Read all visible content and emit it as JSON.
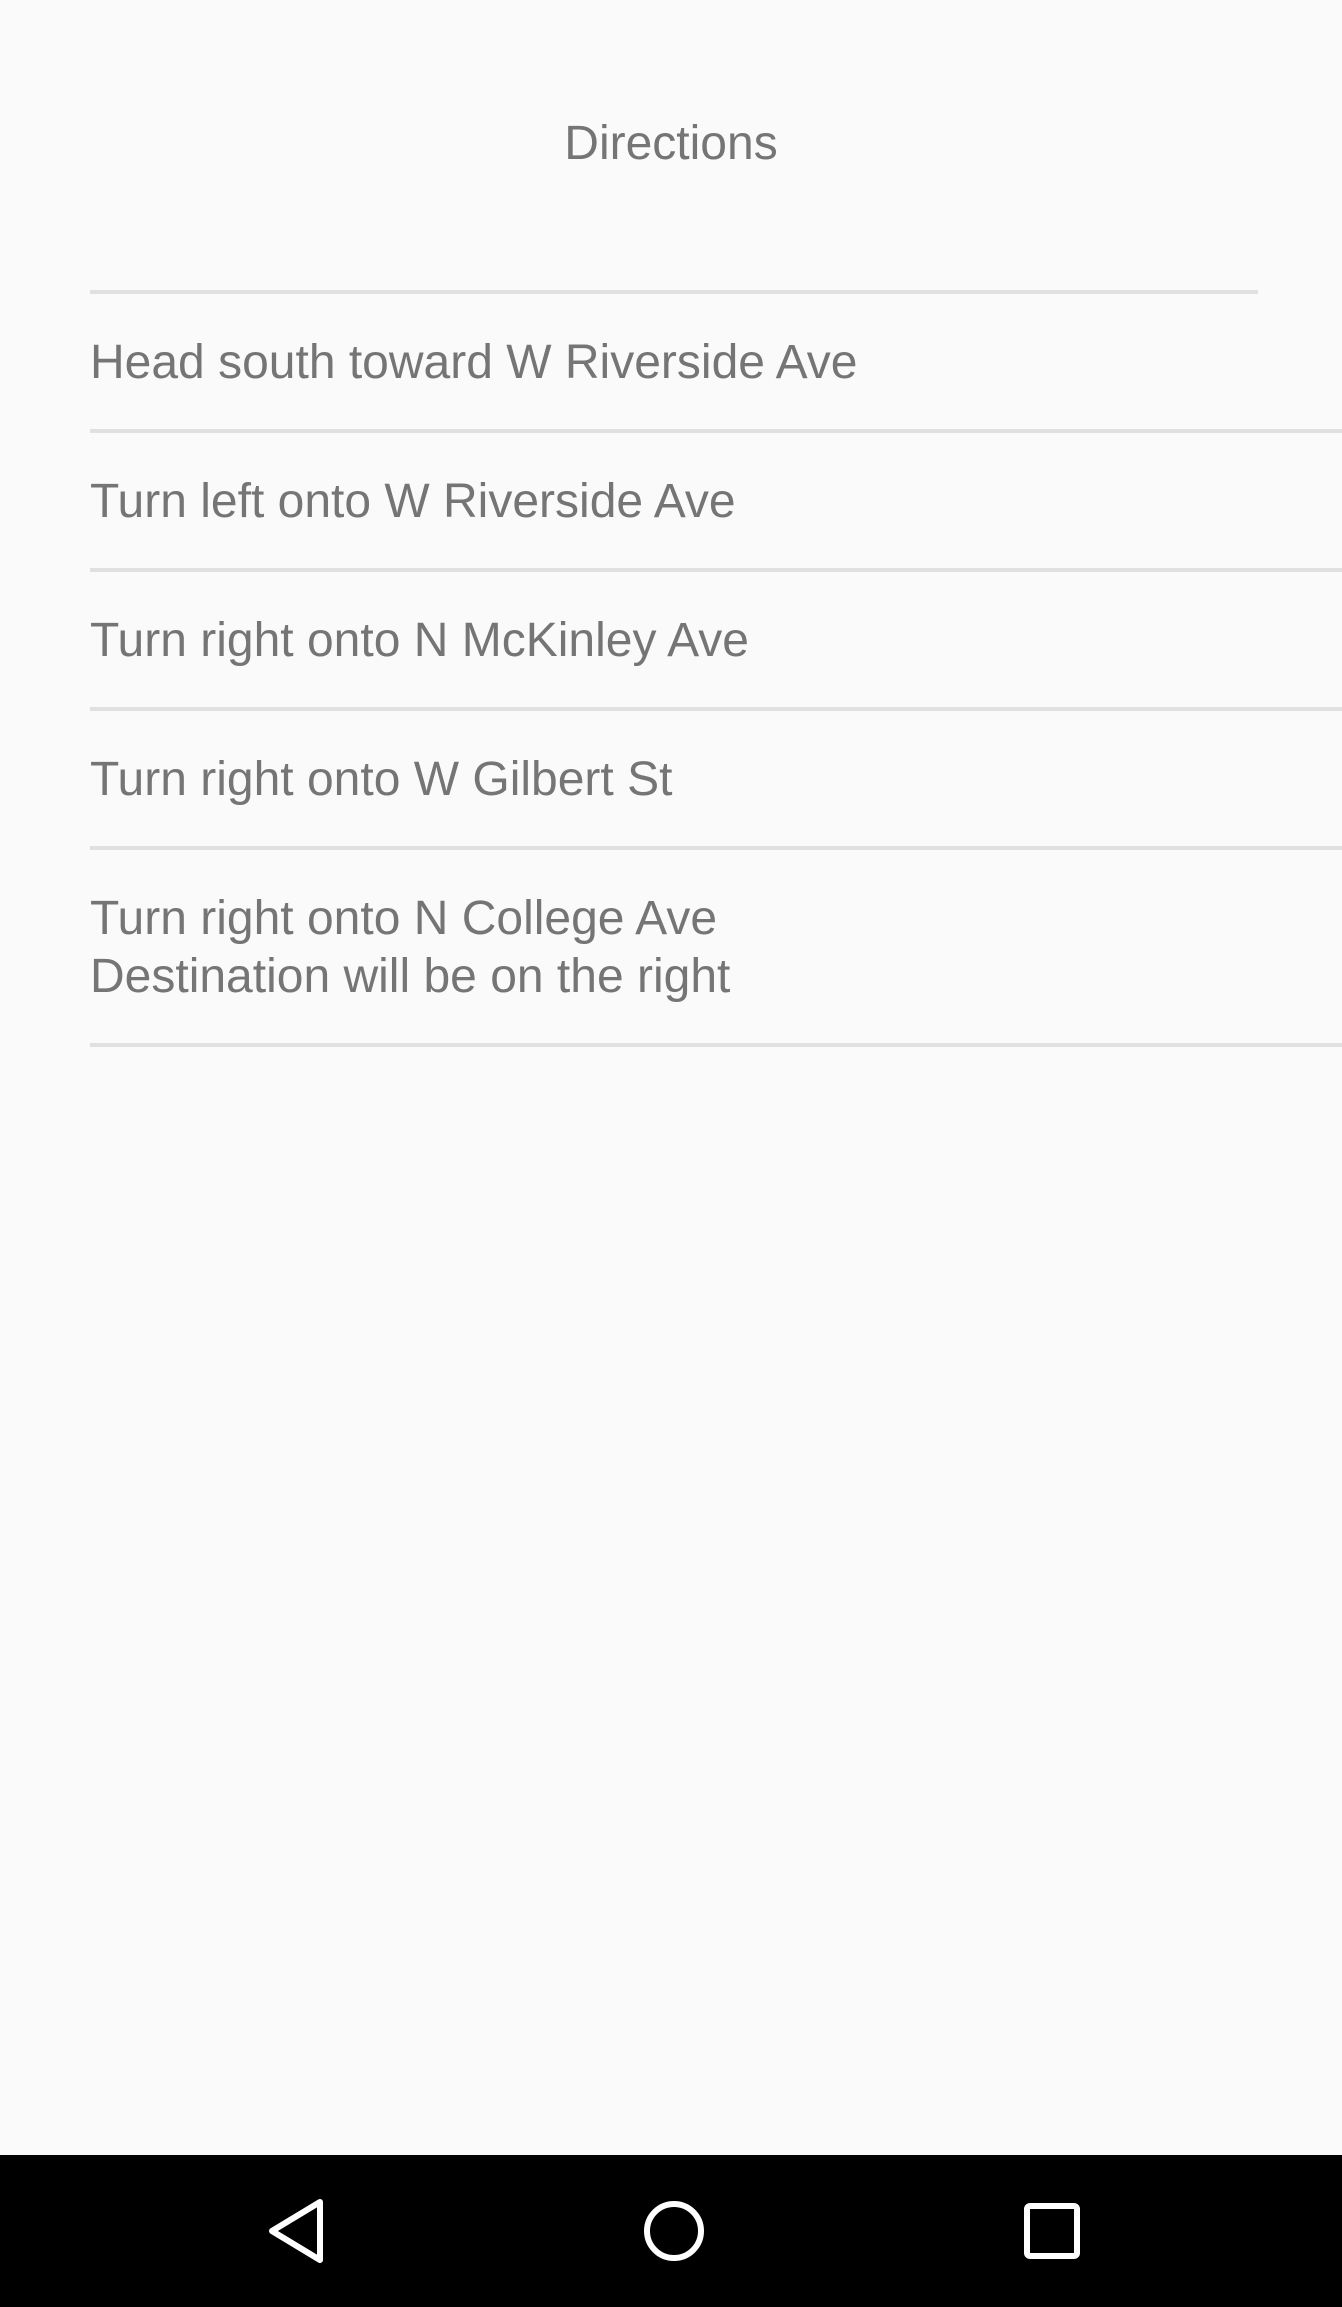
{
  "header": {
    "title": "Directions"
  },
  "steps": [
    {
      "lines": [
        "Head south toward W Riverside Ave"
      ]
    },
    {
      "lines": [
        "Turn left onto W Riverside Ave"
      ]
    },
    {
      "lines": [
        "Turn right onto N McKinley Ave"
      ]
    },
    {
      "lines": [
        "Turn right onto W Gilbert St"
      ]
    },
    {
      "lines": [
        "Turn right onto N College Ave",
        "Destination will be on the right"
      ]
    }
  ],
  "navbar": {
    "buttons": [
      {
        "icon": "back-icon"
      },
      {
        "icon": "home-icon"
      },
      {
        "icon": "recents-icon"
      }
    ]
  },
  "colors": {
    "background": "#fafafa",
    "text": "#757575",
    "divider": "#e0e0e0",
    "navbar": "#000000",
    "nav_icon": "#ffffff"
  }
}
